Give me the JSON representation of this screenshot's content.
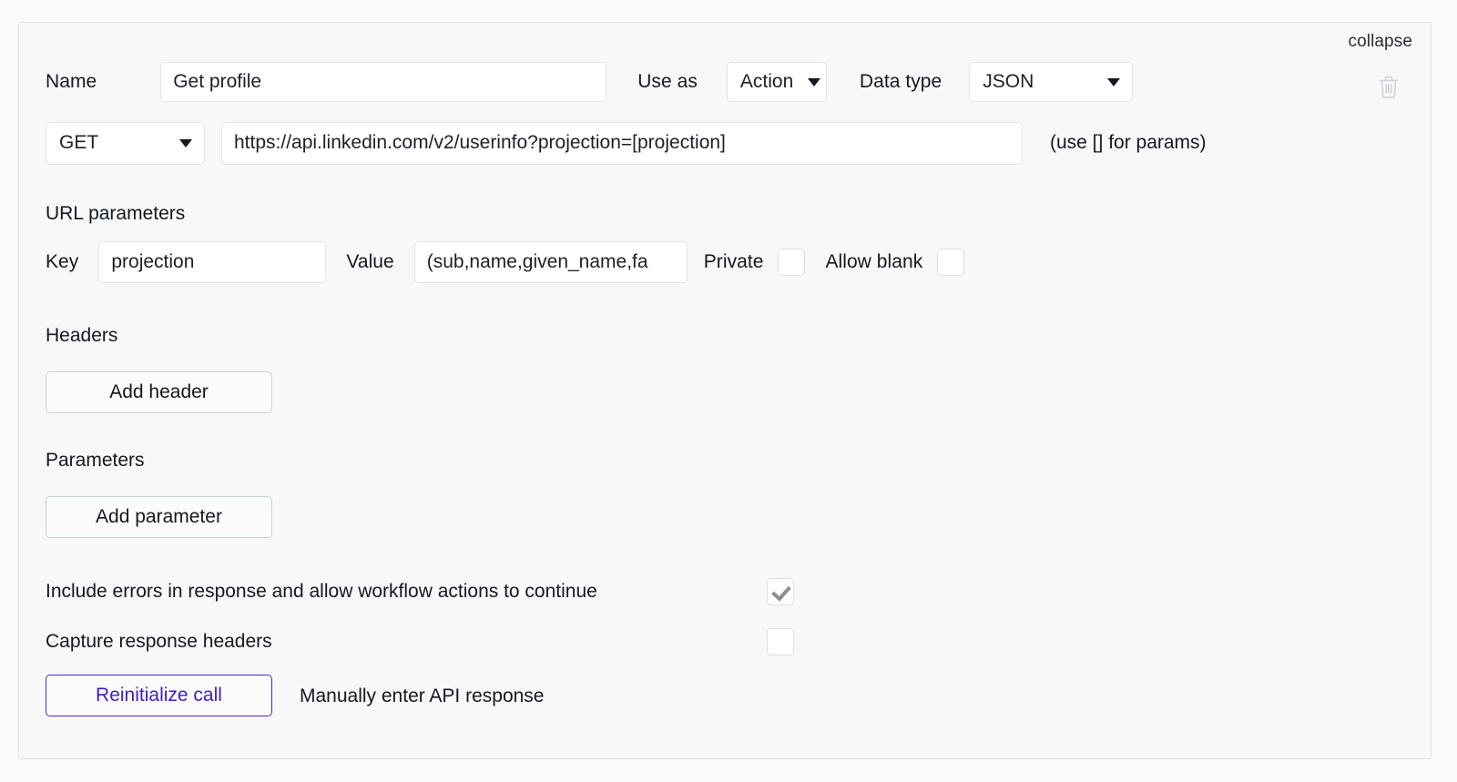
{
  "panel": {
    "collapse_label": "collapse",
    "delete_icon": "trash-icon"
  },
  "name_row": {
    "name_label": "Name",
    "name_value": "Get profile",
    "use_as_label": "Use as",
    "use_as_value": "Action",
    "data_type_label": "Data type",
    "data_type_value": "JSON"
  },
  "url_row": {
    "method_value": "GET",
    "url_value": "https://api.linkedin.com/v2/userinfo?projection=[projection]",
    "hint": "(use [] for params)"
  },
  "url_parameters": {
    "title": "URL parameters",
    "key_label": "Key",
    "key_value": "projection",
    "value_label": "Value",
    "value_value": "(sub,name,given_name,fa",
    "private_label": "Private",
    "private_checked": false,
    "allow_blank_label": "Allow blank",
    "allow_blank_checked": false
  },
  "headers": {
    "title": "Headers",
    "add_button": "Add header"
  },
  "parameters": {
    "title": "Parameters",
    "add_button": "Add parameter"
  },
  "options": {
    "include_errors_label": "Include errors in response and allow workflow actions to continue",
    "include_errors_checked": true,
    "capture_headers_label": "Capture response headers",
    "capture_headers_checked": false
  },
  "footer": {
    "reinitialize_label": "Reinitialize call",
    "manual_response_label": "Manually enter API response"
  },
  "colors": {
    "accent": "#3b1fc4",
    "panel_bg": "#f8f8f8",
    "page_bg": "#fafafa",
    "border": "#e2e3e5"
  }
}
